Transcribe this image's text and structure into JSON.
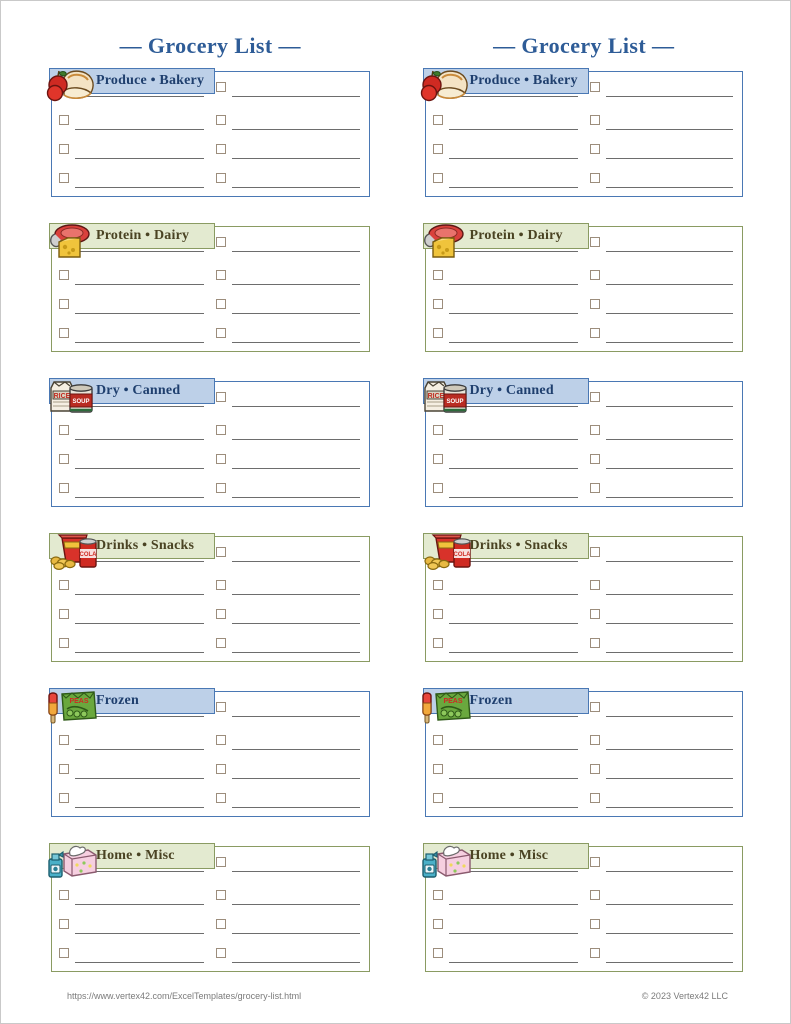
{
  "page": {
    "title": "Grocery List",
    "title_display": "— Grocery List —"
  },
  "columns": [
    {
      "name": "left-column",
      "title": "— Grocery List —",
      "sections": [
        {
          "label": "Produce • Bakery",
          "theme": "blue",
          "icon": "apple-bread-icon",
          "rows": 4
        },
        {
          "label": "Protein • Dairy",
          "theme": "green",
          "icon": "meat-cheese-icon",
          "rows": 4
        },
        {
          "label": "Dry • Canned",
          "theme": "blue",
          "icon": "rice-can-icon",
          "rows": 4
        },
        {
          "label": "Drinks • Snacks",
          "theme": "green",
          "icon": "chips-soda-icon",
          "rows": 4
        },
        {
          "label": "Frozen",
          "theme": "blue",
          "icon": "popsicle-peas-icon",
          "rows": 4
        },
        {
          "label": "Home • Misc",
          "theme": "green",
          "icon": "tissue-spray-icon",
          "rows": 4
        }
      ]
    },
    {
      "name": "right-column",
      "title": "— Grocery List —",
      "sections": [
        {
          "label": "Produce • Bakery",
          "theme": "blue",
          "icon": "apple-bread-icon",
          "rows": 4
        },
        {
          "label": "Protein • Dairy",
          "theme": "green",
          "icon": "meat-cheese-icon",
          "rows": 4
        },
        {
          "label": "Dry • Canned",
          "theme": "blue",
          "icon": "rice-can-icon",
          "rows": 4
        },
        {
          "label": "Drinks • Snacks",
          "theme": "green",
          "icon": "chips-soda-icon",
          "rows": 4
        },
        {
          "label": "Frozen",
          "theme": "blue",
          "icon": "popsicle-peas-icon",
          "rows": 4
        },
        {
          "label": "Home • Misc",
          "theme": "green",
          "icon": "tissue-spray-icon",
          "rows": 4
        }
      ]
    }
  ],
  "footer": {
    "url": "https://www.vertex42.com/ExcelTemplates/grocery-list.html",
    "copyright": "© 2023 Vertex42 LLC"
  },
  "colors": {
    "title_blue": "#2e5c97",
    "blue_header_fill": "#bdd0e8",
    "blue_border": "#4a78b4",
    "blue_text": "#1f3f6e",
    "green_header_fill": "#e3ead0",
    "green_border": "#8a9b62",
    "green_text": "#4a4323",
    "checkbox_border": "#9c8d7c",
    "writeline": "#6d6d6d",
    "footer_text": "#7b7b7b"
  }
}
